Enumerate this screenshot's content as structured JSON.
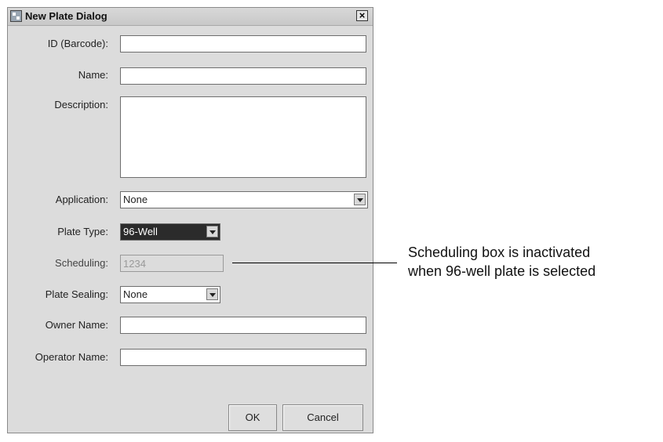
{
  "dialog": {
    "title": "New Plate Dialog",
    "close_glyph": "×"
  },
  "form": {
    "id_label": "ID (Barcode):",
    "id_value": "",
    "name_label": "Name:",
    "name_value": "",
    "description_label": "Description:",
    "description_value": "",
    "application_label": "Application:",
    "application_value": "None",
    "plate_type_label": "Plate Type:",
    "plate_type_value": "96-Well",
    "scheduling_label": "Scheduling:",
    "scheduling_value": "1234",
    "scheduling_enabled": false,
    "plate_sealing_label": "Plate Sealing:",
    "plate_sealing_value": "None",
    "owner_label": "Owner Name:",
    "owner_value": "",
    "operator_label": "Operator Name:",
    "operator_value": ""
  },
  "buttons": {
    "ok": "OK",
    "cancel": "Cancel"
  },
  "annotation": {
    "line1": "Scheduling box is inactivated",
    "line2": "when 96-well plate is selected"
  }
}
